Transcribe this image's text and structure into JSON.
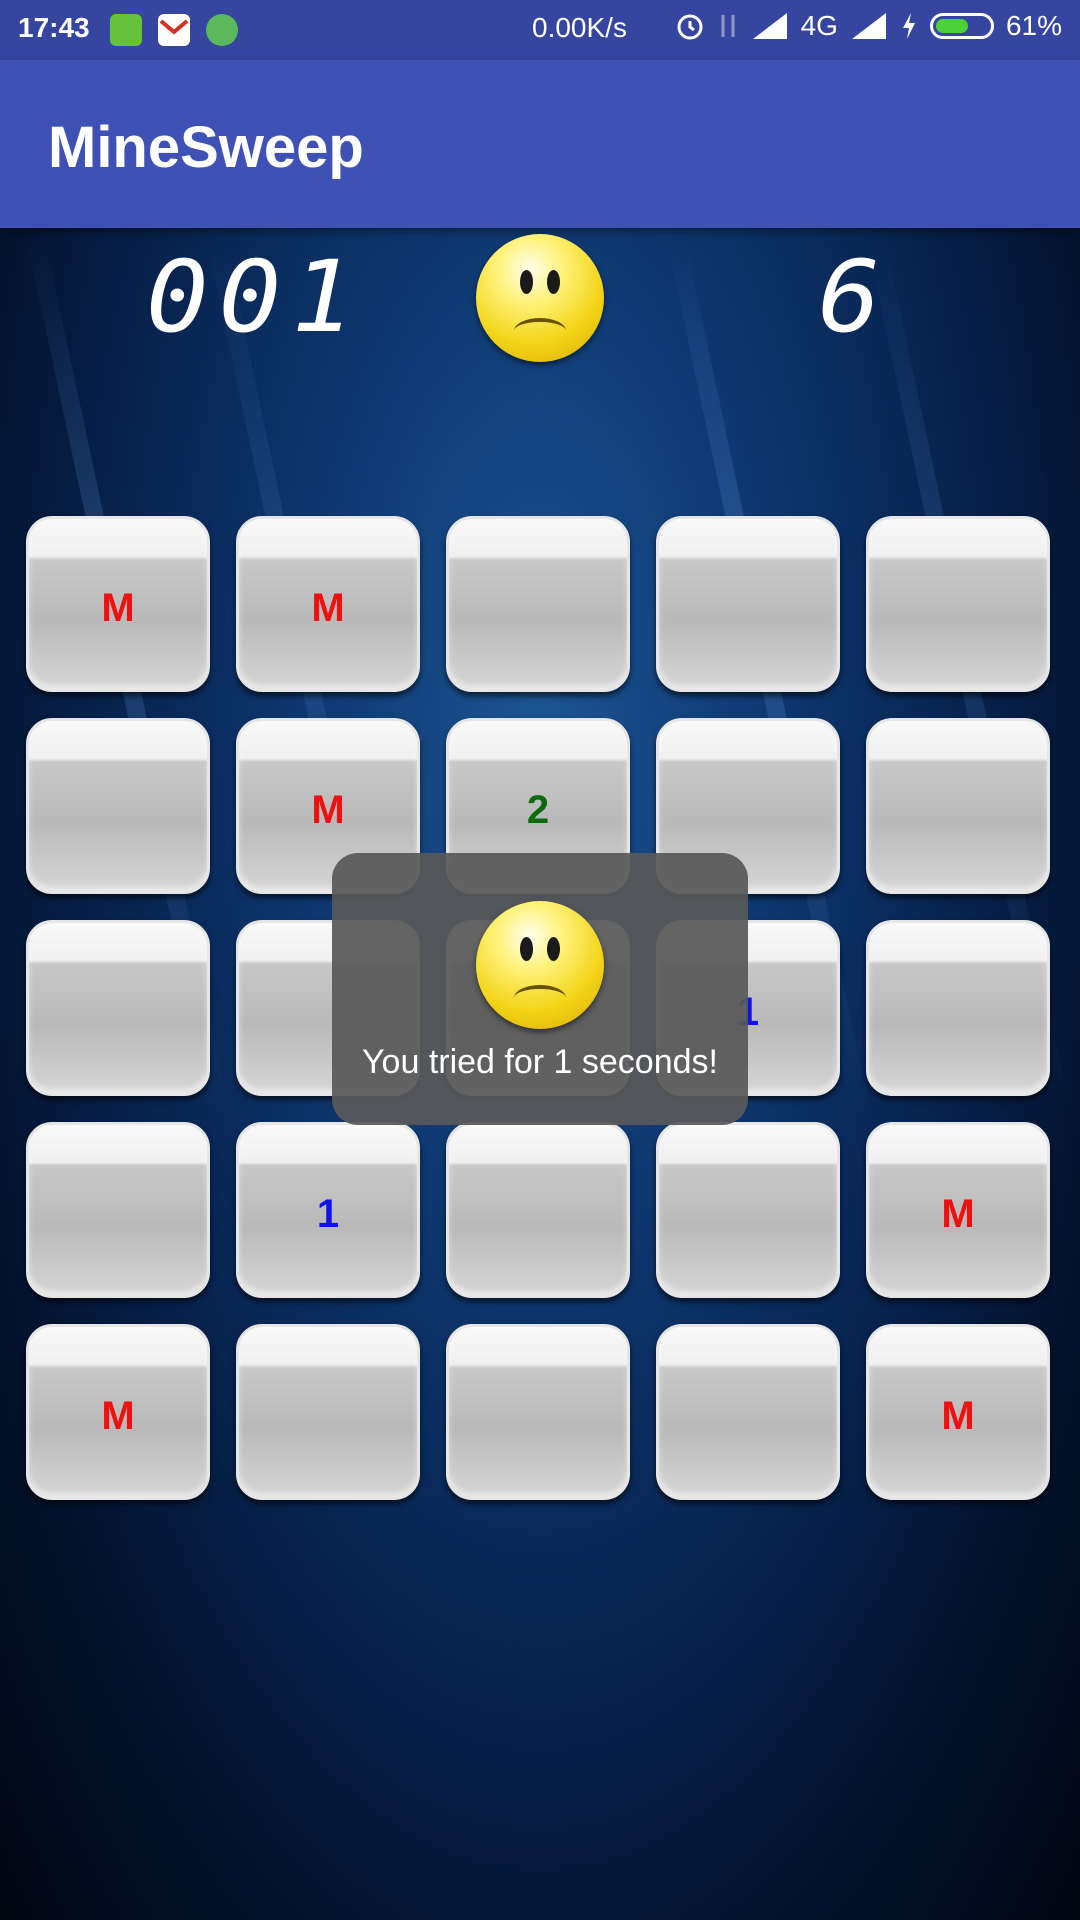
{
  "status_bar": {
    "time": "17:43",
    "network_speed": "0.00K/s",
    "network_type": "4G",
    "battery_percent": "61%",
    "battery_level": 0.61,
    "notification_icons": [
      "battery-saver-icon",
      "gmail-icon",
      "chat-app-icon"
    ]
  },
  "app": {
    "title": "MineSweep",
    "primary_color": "#3f51b5"
  },
  "game": {
    "timer": "001",
    "mines_remaining": "6",
    "face_state": "sad-face-icon",
    "board": [
      [
        "M",
        "M",
        "",
        "",
        ""
      ],
      [
        "",
        "M",
        "2",
        "",
        ""
      ],
      [
        "",
        "",
        "",
        "1",
        ""
      ],
      [
        "",
        "1",
        "",
        "",
        "M"
      ],
      [
        "M",
        "",
        "",
        "",
        "M"
      ]
    ]
  },
  "toast": {
    "message": "You tried for 1 seconds!"
  }
}
